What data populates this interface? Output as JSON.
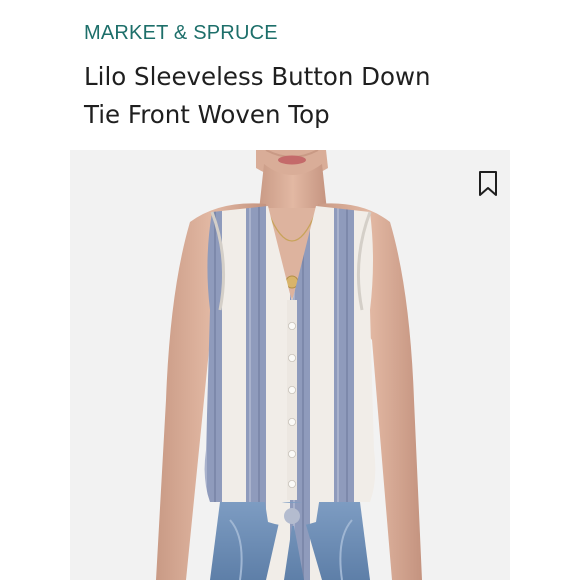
{
  "brand": {
    "name": "MARKET & SPRUCE",
    "color": "#1d6f6a"
  },
  "product": {
    "title_line1": "Lilo Sleeveless Button Down",
    "title_line2": "Tie Front Woven Top"
  },
  "image": {
    "alt": "Model wearing a blue and white vertically striped sleeveless button down tie front top with jeans"
  },
  "icons": {
    "bookmark": "bookmark-icon"
  },
  "colors": {
    "stripe_blue": "#8f9bbc",
    "stripe_white": "#f1ede8",
    "photo_background": "#f2f2f2"
  }
}
